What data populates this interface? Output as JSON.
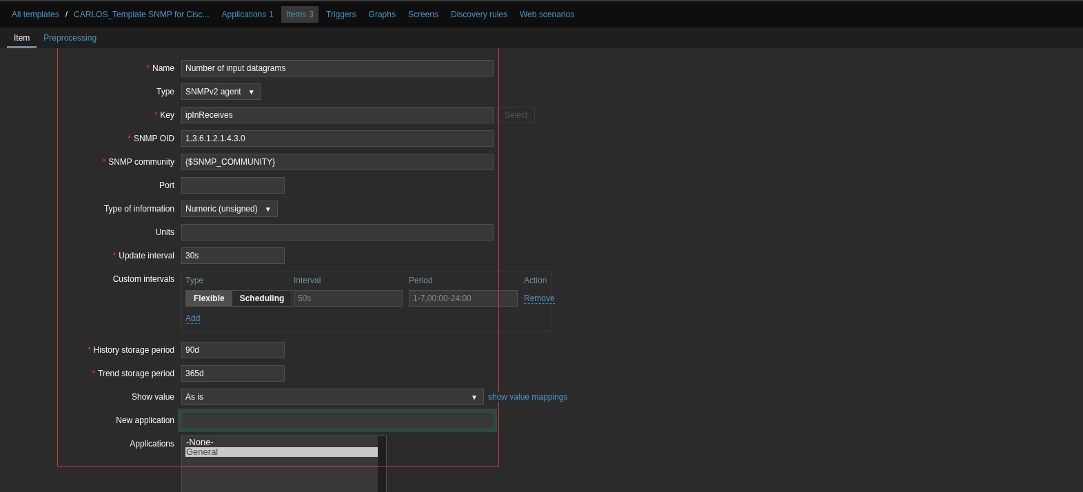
{
  "breadcrumbs": [
    {
      "label": "All templates",
      "selected": false
    },
    {
      "label": "CARLOS_Template SNMP for Cisc...",
      "selected": false
    },
    {
      "label": "Applications",
      "count": "1",
      "selected": false
    },
    {
      "label": "Items",
      "count": "3",
      "selected": true
    },
    {
      "label": "Triggers",
      "selected": false
    },
    {
      "label": "Graphs",
      "selected": false
    },
    {
      "label": "Screens",
      "selected": false
    },
    {
      "label": "Discovery rules",
      "selected": false
    },
    {
      "label": "Web scenarios",
      "selected": false
    }
  ],
  "separator": "/",
  "required_mark": "*",
  "tabs": [
    {
      "label": "Item",
      "selected": true
    },
    {
      "label": "Preprocessing",
      "selected": false
    }
  ],
  "fields": [
    {
      "kind": "text",
      "label": "Name",
      "required": true,
      "value": "Number of input datagrams"
    },
    {
      "kind": "select",
      "label": "Type",
      "required": false,
      "value": "SNMPv2 agent",
      "arrow": "▼"
    },
    {
      "kind": "text",
      "label": "Key",
      "required": true,
      "value": "ipInReceives",
      "button": {
        "label": "Select",
        "disabled": true
      }
    },
    {
      "kind": "text",
      "label": "SNMP OID",
      "required": true,
      "value": "1.3.6.1.2.1.4.3.0"
    },
    {
      "kind": "text",
      "label": "SNMP community",
      "required": true,
      "value": "{$SNMP_COMMUNITY}"
    },
    {
      "kind": "short",
      "label": "Port",
      "required": false
    },
    {
      "kind": "select",
      "label": "Type of information",
      "required": false,
      "value": "Numeric (unsigned)",
      "arrow": "▼"
    },
    {
      "kind": "text",
      "label": "Units",
      "required": false
    },
    {
      "kind": "short",
      "label": "Update interval",
      "required": true,
      "value": "30s"
    },
    {
      "kind": "intervals",
      "label": "Custom intervals",
      "required": false,
      "columns": [
        "Type",
        "Interval",
        "Period",
        "Action"
      ],
      "rows": [
        {
          "options": [
            {
              "label": "Flexible",
              "selected": true
            },
            {
              "label": "Scheduling",
              "selected": false
            }
          ],
          "interval_placeholder": "50s",
          "period_placeholder": "1-7,00:00-24:00",
          "action": "Remove"
        }
      ],
      "add": "Add"
    },
    {
      "kind": "short",
      "label": "History storage period",
      "required": true,
      "value": "90d"
    },
    {
      "kind": "short",
      "label": "Trend storage period",
      "required": true,
      "value": "365d"
    },
    {
      "kind": "wideselect",
      "label": "Show value",
      "required": false,
      "value": "As is",
      "arrow": "▼",
      "link": "show value mappings"
    },
    {
      "kind": "text",
      "label": "New application",
      "required": false,
      "focused": true
    },
    {
      "kind": "list",
      "label": "Applications",
      "required": false,
      "options": [
        {
          "label": "-None-",
          "selected": false
        },
        {
          "label": "General",
          "selected": true
        }
      ]
    }
  ]
}
